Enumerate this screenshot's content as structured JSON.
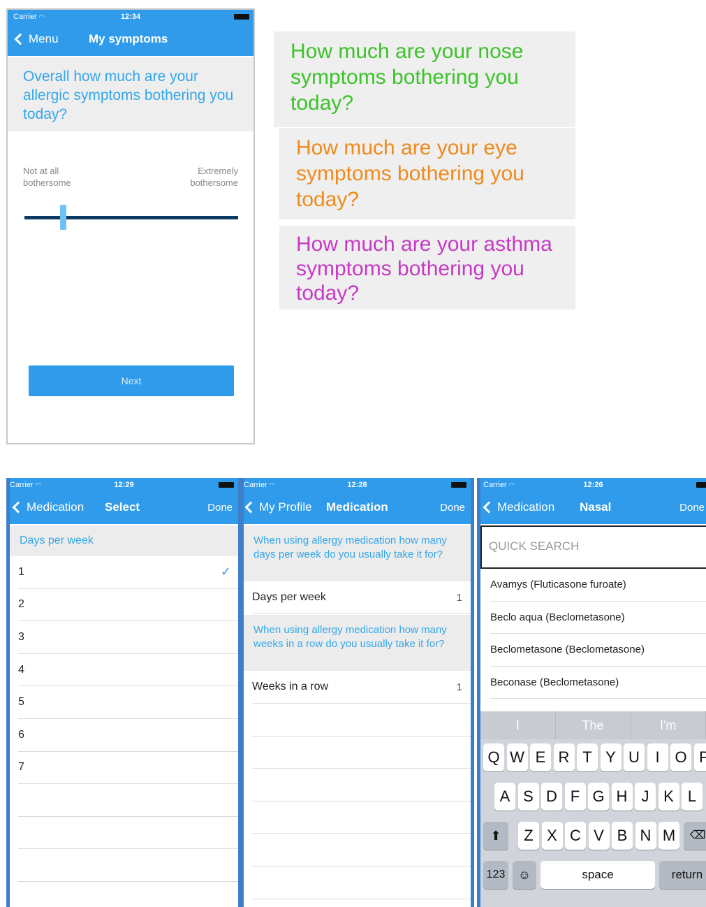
{
  "symptoms_screen": {
    "carrier": "Carrier",
    "time": "12:34",
    "back_label": "Menu",
    "title": "My symptoms",
    "question": "Overall how much are your allergic symptoms bothering you today?",
    "slider_min_label_1": "Not at all",
    "slider_min_label_2": "bothersome",
    "slider_max_label_1": "Extremely",
    "slider_max_label_2": "bothersome",
    "slider_value_fraction": 0.18,
    "next_label": "Next"
  },
  "questions": {
    "nose": "How much are your nose symptoms bothering you today?",
    "eye": "How much are your eye symptoms bothering you today?",
    "asthma": "How much are your asthma symptoms bothering you today?",
    "colors": {
      "nose": "#3cc32a",
      "eye": "#ef8a1c",
      "asthma": "#c63ac3"
    }
  },
  "select_screen": {
    "carrier": "Carrier",
    "time": "12:29",
    "back_label": "Medication",
    "title": "Select",
    "done_label": "Done",
    "section_header": "Days per week",
    "options": [
      "1",
      "2",
      "3",
      "4",
      "5",
      "6",
      "7"
    ],
    "selected_option": "1"
  },
  "medication_screen": {
    "carrier": "Carrier",
    "time": "12:28",
    "back_label": "My Profile",
    "title": "Medication",
    "done_label": "Done",
    "question_days": "When using allergy medication how many days per week do you usually take it for?",
    "days_label": "Days per week",
    "days_value": "1",
    "question_weeks": "When using allergy medication how many weeks in a row do you usually take it for?",
    "weeks_label": "Weeks in a row",
    "weeks_value": "1"
  },
  "nasal_screen": {
    "carrier": "Carrier",
    "time": "12:26",
    "back_label": "Medication",
    "title": "Nasal",
    "done_label": "Done",
    "search_placeholder": "QUICK SEARCH",
    "results": [
      "Avamys (Fluticasone furoate)",
      "Beclo aqua (Beclometasone)",
      "Beclometasone (Beclometasone)",
      "Beconase (Beclometasone)"
    ],
    "suggestions": [
      "I",
      "The",
      "I'm"
    ],
    "keyboard_row1": [
      "Q",
      "W",
      "E",
      "R",
      "T",
      "Y",
      "U",
      "I",
      "O",
      "P"
    ],
    "keyboard_row2": [
      "A",
      "S",
      "D",
      "F",
      "G",
      "H",
      "J",
      "K",
      "L"
    ],
    "keyboard_row3": [
      "Z",
      "X",
      "C",
      "V",
      "B",
      "N",
      "M"
    ],
    "key_123": "123",
    "key_space": "space",
    "key_return": "return"
  },
  "colors": {
    "accent": "#2f9bea",
    "header_text": "#34a7ea",
    "slider_track": "#0b3a63"
  }
}
